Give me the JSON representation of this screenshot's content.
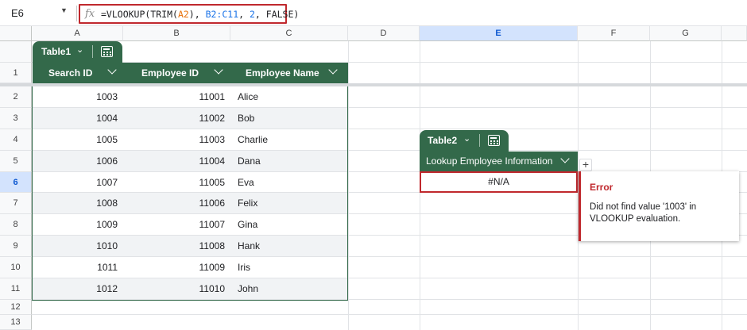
{
  "formula_bar": {
    "name_box": "E6",
    "fx_symbol": "fx",
    "formula_prefix": "=VLOOKUP(TRIM(",
    "formula_ref1": "A2",
    "formula_mid": "), ",
    "formula_ref2": "B2:C11",
    "formula_sep": ", ",
    "formula_num": "2",
    "formula_tail": ", FALSE)"
  },
  "columns": [
    "A",
    "B",
    "C",
    "D",
    "E",
    "F",
    "G"
  ],
  "rows": [
    "1",
    "2",
    "3",
    "4",
    "5",
    "6",
    "7",
    "8",
    "9",
    "10",
    "11",
    "12",
    "13"
  ],
  "table1": {
    "name": "Table1",
    "headers": [
      "Search ID",
      "Employee ID",
      "Employee Name"
    ],
    "rows": [
      {
        "search_id": "1003",
        "employee_id": "11001",
        "employee_name": "Alice"
      },
      {
        "search_id": "1004",
        "employee_id": "11002",
        "employee_name": "Bob"
      },
      {
        "search_id": "1005",
        "employee_id": "11003",
        "employee_name": "Charlie"
      },
      {
        "search_id": "1006",
        "employee_id": "11004",
        "employee_name": "Dana"
      },
      {
        "search_id": "1007",
        "employee_id": "11005",
        "employee_name": "Eva"
      },
      {
        "search_id": "1008",
        "employee_id": "11006",
        "employee_name": "Felix"
      },
      {
        "search_id": "1009",
        "employee_id": "11007",
        "employee_name": "Gina"
      },
      {
        "search_id": "1010",
        "employee_id": "11008",
        "employee_name": "Hank"
      },
      {
        "search_id": "1011",
        "employee_id": "11009",
        "employee_name": "Iris"
      },
      {
        "search_id": "1012",
        "employee_id": "11010",
        "employee_name": "John"
      }
    ]
  },
  "table2": {
    "name": "Table2",
    "header": "Lookup Employee Information",
    "cell_value": "#N/A",
    "add_column": "+"
  },
  "error_popup": {
    "title": "Error",
    "message": "Did not find value '1003' in VLOOKUP evaluation."
  },
  "colors": {
    "table_green": "#33694a",
    "error_red": "#c0282d",
    "selection_blue": "#d3e3fd"
  }
}
